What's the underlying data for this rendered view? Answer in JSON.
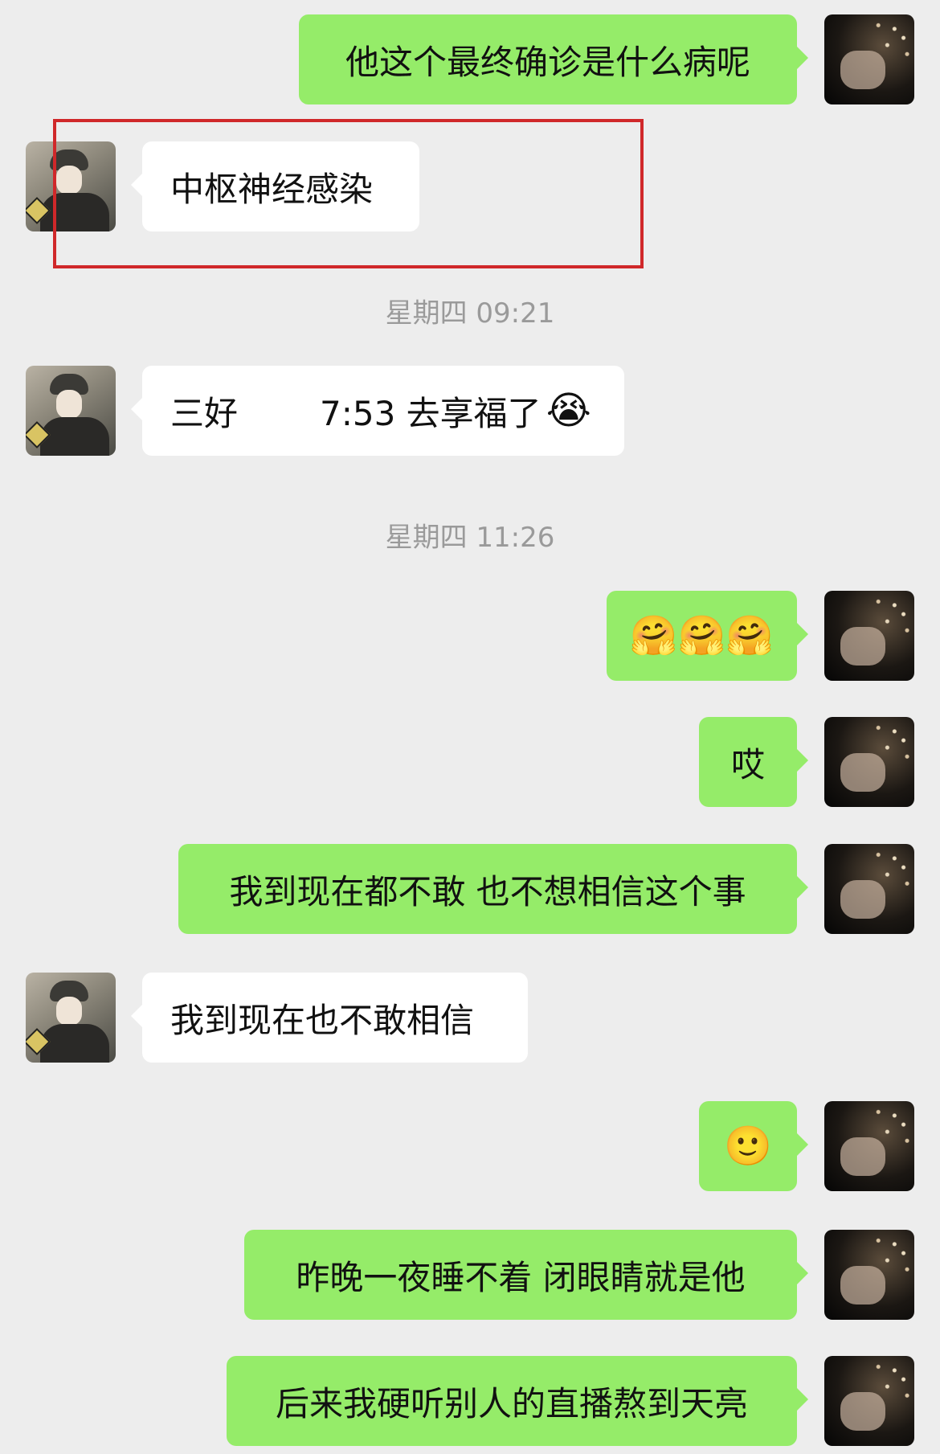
{
  "messages": [
    {
      "side": "right",
      "text": "他这个最终确诊是什么病呢"
    },
    {
      "side": "left",
      "text": "中枢神经感染",
      "highlighted": true
    },
    {
      "side": "left",
      "text_before": "三好",
      "text_after": "7:53 去享福了",
      "emoji": "😭"
    },
    {
      "side": "right",
      "emoji": "🤗🤗🤗"
    },
    {
      "side": "right",
      "text": "哎"
    },
    {
      "side": "right",
      "text": "我到现在都不敢 也不想相信这个事"
    },
    {
      "side": "left",
      "text": "我到现在也不敢相信"
    },
    {
      "side": "right",
      "emoji": "🙂"
    },
    {
      "side": "right",
      "text": "昨晚一夜睡不着 闭眼睛就是他"
    },
    {
      "side": "right",
      "text": "后来我硬听别人的直播熬到天亮"
    }
  ],
  "timestamps": [
    "星期四 09:21",
    "星期四 11:26"
  ],
  "colors": {
    "background": "#ededed",
    "outgoing_bubble": "#95ec69",
    "incoming_bubble": "#ffffff",
    "highlight_border": "#d0282a"
  }
}
